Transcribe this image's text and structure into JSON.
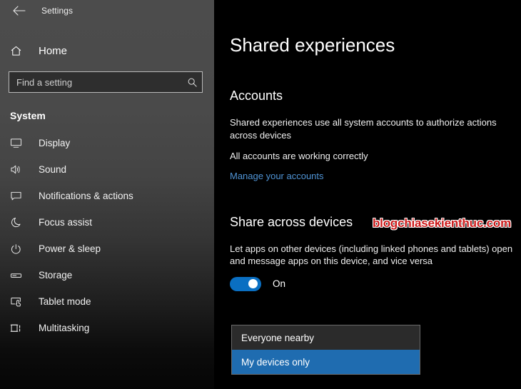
{
  "window": {
    "title": "Settings",
    "back_icon": "back-arrow-icon"
  },
  "sidebar": {
    "home": {
      "label": "Home",
      "icon": "home-icon"
    },
    "search": {
      "placeholder": "Find a setting",
      "value": "",
      "icon": "search-icon"
    },
    "section_title": "System",
    "items": [
      {
        "label": "Display",
        "icon": "monitor-icon"
      },
      {
        "label": "Sound",
        "icon": "speaker-icon"
      },
      {
        "label": "Notifications & actions",
        "icon": "notification-icon"
      },
      {
        "label": "Focus assist",
        "icon": "moon-icon"
      },
      {
        "label": "Power & sleep",
        "icon": "power-icon"
      },
      {
        "label": "Storage",
        "icon": "drive-icon"
      },
      {
        "label": "Tablet mode",
        "icon": "tablet-icon"
      },
      {
        "label": "Multitasking",
        "icon": "multitasking-icon"
      }
    ]
  },
  "main": {
    "page_title": "Shared experiences",
    "accounts": {
      "heading": "Accounts",
      "description": "Shared experiences use all system accounts to authorize actions across devices",
      "status": "All accounts are working correctly",
      "link": "Manage your accounts"
    },
    "share_across_devices": {
      "heading": "Share across devices",
      "description": "Let apps on other devices (including linked phones and tablets) open and message apps on this device, and vice versa",
      "toggle_state": "On",
      "toggle_on": true,
      "dropdown": {
        "selected": "My devices only",
        "options": [
          {
            "label": "Everyone nearby",
            "selected": false
          },
          {
            "label": "My devices only",
            "selected": true
          }
        ]
      }
    }
  },
  "watermark": {
    "text": "blogchiasekienthuc.com"
  },
  "colors": {
    "accent": "#0a6fc2",
    "highlight": "#1f6cb0",
    "link": "#4f93d4",
    "watermark": "#cc1a1a",
    "sidebar_top": "#4c4c4c",
    "main_bg": "#000000"
  }
}
